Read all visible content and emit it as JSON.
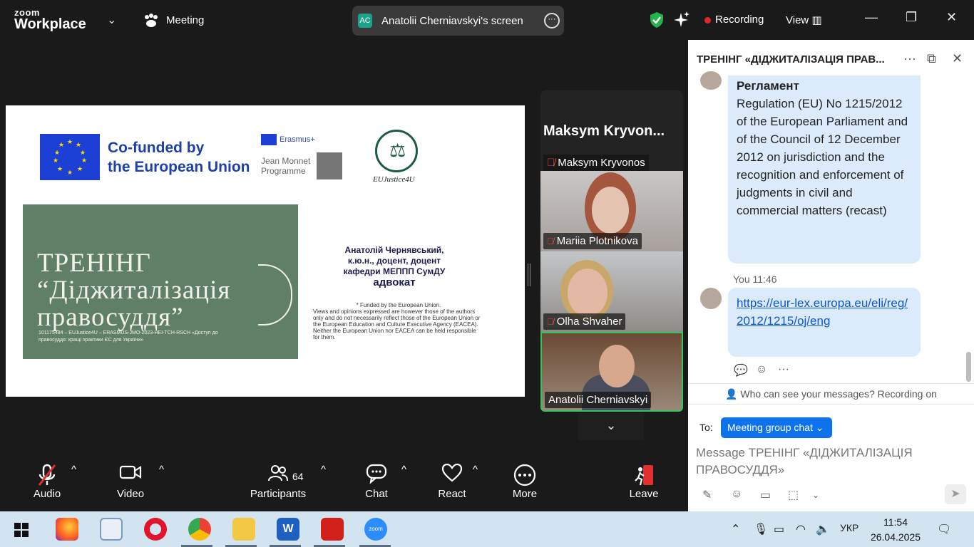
{
  "app": {
    "brand_line1": "zoom",
    "brand_line2": "Workplace",
    "meeting_label": "Meeting"
  },
  "share": {
    "initials": "AC",
    "title": "Anatolii Cherniavskyi's screen"
  },
  "top": {
    "recording_label": "Recording",
    "view_label": "View"
  },
  "slide": {
    "cofunded": "Co-funded by\nthe European Union",
    "erasmus": "Erasmus+",
    "jean_monnet": "Jean Monnet\nProgramme",
    "emblem_name": "EUJustice4U",
    "training_title": "ТРЕНІНГ\n“Діджиталізація\nправосуддя”",
    "project_line": "101175484 – EUJustice4U – ERASMUS-JMO-2023-HEI-TCH-RSCH «Доступ до правосуддя: кращі практики ЄС для України»",
    "author_line": "Анатолій Чернявський,\nк.ю.н., доцент, доцент\nкафедри МЕППП СумДУ",
    "author_role": "адвокат",
    "funded_title": "* Funded by the European Union.",
    "funded_body": "Views and opinions expressed are however those of the authors only and do not necessarily reflect those of the European Union or the European Education and Culture Executive Agency (EACEA). Neither the European Union nor EACEA can be held responsible for them."
  },
  "participants": {
    "header_name": "Maksym  Kryvon...",
    "tiles": [
      {
        "name": "Maksym Kryvonos",
        "muted": true
      },
      {
        "name": "Mariia Plotnikova",
        "muted": true
      },
      {
        "name": "Olha Shvaher",
        "muted": true
      },
      {
        "name": "Anatolii Cherniavskyi",
        "muted": false,
        "active_speaker": true
      }
    ]
  },
  "toolbar": {
    "audio": "Audio",
    "video": "Video",
    "participants": "Participants",
    "participants_count": "64",
    "chat": "Chat",
    "react": "React",
    "more": "More",
    "leave": "Leave"
  },
  "chat": {
    "title": "ТРЕНІНГ «ДІДЖИТАЛІЗАЦІЯ ПРАВ...",
    "msg1_bold": "Регламент",
    "msg1_body": "Regulation (EU) No 1215/2012 of the European Parliament and of the Council of 12 December 2012 on jurisdiction and the recognition and enforcement of judgments in civil and commercial matters (recast)",
    "msg2_sender": "You",
    "msg2_time": "11:46",
    "msg2_link": "https://eur-lex.europa.eu/eli/reg/2012/1215/oj/eng",
    "who_can_see": "Who can see your messages? Recording on",
    "to_label": "To:",
    "recipient": "Meeting group chat",
    "input_placeholder": "Message ТРЕНІНГ «ДІДЖИТАЛІЗАЦІЯ ПРАВОСУДДЯ»"
  },
  "taskbar": {
    "lang": "УКР",
    "time": "11:54",
    "date": "26.04.2025"
  },
  "colors": {
    "accent": "#0e72ed",
    "recording": "#e02828",
    "speaker_border": "#30c85a",
    "chat_bubble": "#dcebfb"
  }
}
